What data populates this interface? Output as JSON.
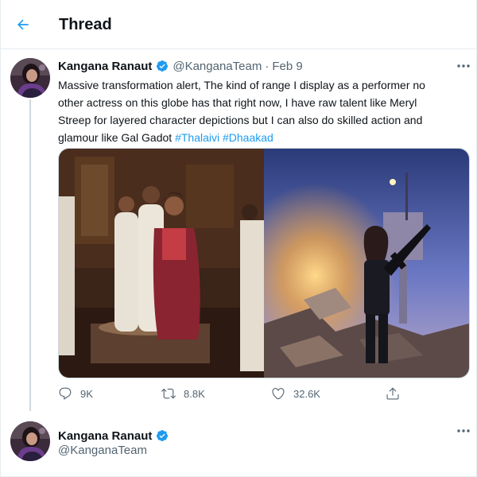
{
  "header": {
    "title": "Thread"
  },
  "tweet": {
    "author_name": "Kangana Ranaut",
    "handle": "@KanganaTeam",
    "separator": "·",
    "date": "Feb 9",
    "text_lines": [
      "Massive transformation alert, The kind of range I display as a performer no",
      "other actress on this globe has that right now, I have raw talent like Meryl",
      "Streep for layered character depictions but I can also do skilled action and"
    ],
    "last_line_text": "glamour like Gal Gadot",
    "hashtags": [
      "#Thalaivi",
      "#Dhaakad"
    ],
    "stats": {
      "replies": "9K",
      "retweets": "8.8K",
      "likes": "32.6K"
    }
  },
  "reply": {
    "author_name": "Kangana Ranaut",
    "handle": "@KanganaTeam"
  },
  "colors": {
    "accent": "#1d9bf0",
    "text_primary": "#0f1419",
    "text_secondary": "#536471",
    "border": "#e6ecf0"
  },
  "icons": [
    "back-arrow-icon",
    "verified-badge-icon",
    "more-icon",
    "reply-icon",
    "retweet-icon",
    "like-icon",
    "share-icon"
  ]
}
